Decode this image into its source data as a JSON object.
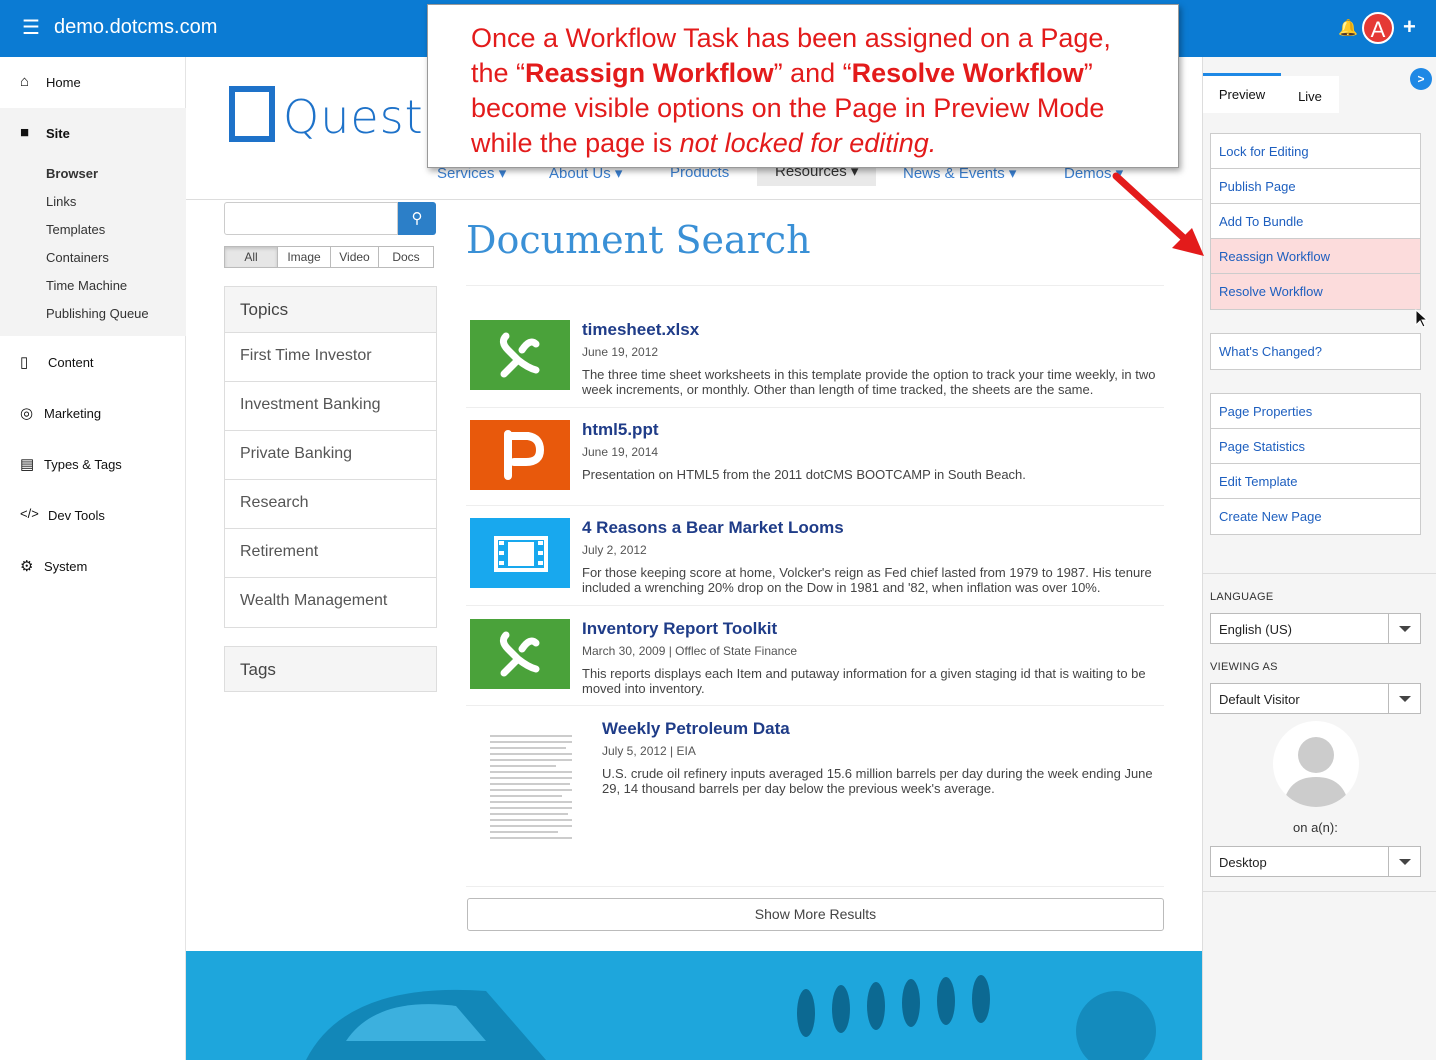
{
  "topbar": {
    "site": "demo.dotcms.com",
    "avatar_letter": "A"
  },
  "leftnav": {
    "home": "Home",
    "site": "Site",
    "site_items": [
      "Browser",
      "Links",
      "Templates",
      "Containers",
      "Time Machine",
      "Publishing Queue"
    ],
    "content": "Content",
    "marketing": "Marketing",
    "types_tags": "Types & Tags",
    "dev_tools": "Dev Tools",
    "system": "System"
  },
  "site_logo": "Quest",
  "mainnav": [
    "Services",
    "About Us",
    "Products",
    "Resources",
    "News & Events",
    "Demos"
  ],
  "search": {
    "placeholder": "",
    "filters": [
      "All",
      "Image",
      "Video",
      "Docs"
    ]
  },
  "topics": {
    "heading": "Topics",
    "items": [
      "First Time Investor",
      "Investment Banking",
      "Private Banking",
      "Research",
      "Retirement",
      "Wealth Management"
    ]
  },
  "tags_heading": "Tags",
  "page_title": "Document Search",
  "results": [
    {
      "title": "timesheet.xlsx",
      "date": "June 19, 2012",
      "desc": "The three time sheet worksheets in this template provide the option to track your time weekly, in two week increments, or monthly. Other than length of time tracked, the sheets are the same.",
      "icon": "excel-icon",
      "color": "#4aa23a"
    },
    {
      "title": "html5.ppt",
      "date": "June 19, 2014",
      "desc": "Presentation on HTML5 from the 2011 dotCMS BOOTCAMP in South Beach.",
      "icon": "powerpoint-icon",
      "color": "#e8590c"
    },
    {
      "title": "4 Reasons a Bear Market Looms",
      "date": "July 2, 2012",
      "desc": "For those keeping score at home, Volcker's reign as Fed chief lasted from 1979 to 1987. His tenure included a wrenching 20% drop on the Dow in 1981 and '82, when inflation was over 10%.",
      "icon": "video-icon",
      "color": "#18a8ee"
    },
    {
      "title": "Inventory Report Toolkit",
      "date": "March 30, 2009   |   Offlec of State Finance",
      "desc": "This reports displays each Item and putaway information for a given staging id that is waiting to be moved into inventory.",
      "icon": "excel-icon",
      "color": "#4aa23a"
    },
    {
      "title": "Weekly Petroleum Data",
      "date": "July 5, 2012   |   EIA",
      "desc": "U.S. crude oil refinery inputs averaged 15.6 million barrels per day during the week ending June 29, 14 thousand barrels per day below the previous week's average.",
      "icon": "document-thumbnail",
      "color": "#ffffff"
    }
  ],
  "show_more": "Show More Results",
  "rightpanel": {
    "tabs": [
      "Preview",
      "Live"
    ],
    "actions_1": [
      "Lock for Editing",
      "Publish Page",
      "Add To Bundle",
      "Reassign Workflow",
      "Resolve Workflow"
    ],
    "actions_2": [
      "What's Changed?"
    ],
    "actions_3": [
      "Page Properties",
      "Page Statistics",
      "Edit Template",
      "Create New Page"
    ],
    "language_label": "LANGUAGE",
    "language": "English (US)",
    "viewing_label": "VIEWING AS",
    "viewing": "Default Visitor",
    "on_an": "on a(n):",
    "device": "Desktop"
  },
  "callout": {
    "line1": "Once a Workflow Task has been assigned on a Page,",
    "line2_a": "the “",
    "line2_b": "Reassign Workflow",
    "line2_c": "” and “",
    "line2_d": "Resolve Workflow",
    "line2_e": "”",
    "line3": "become visible options on the Page in Preview Mode",
    "line4_a": "while the page is ",
    "line4_b": "not locked for editing."
  },
  "colors": {
    "topbar": "#0b7bd3",
    "accent": "#1e88e5",
    "callout_text": "#e31b1b",
    "highlight": "#fcdcdc"
  }
}
